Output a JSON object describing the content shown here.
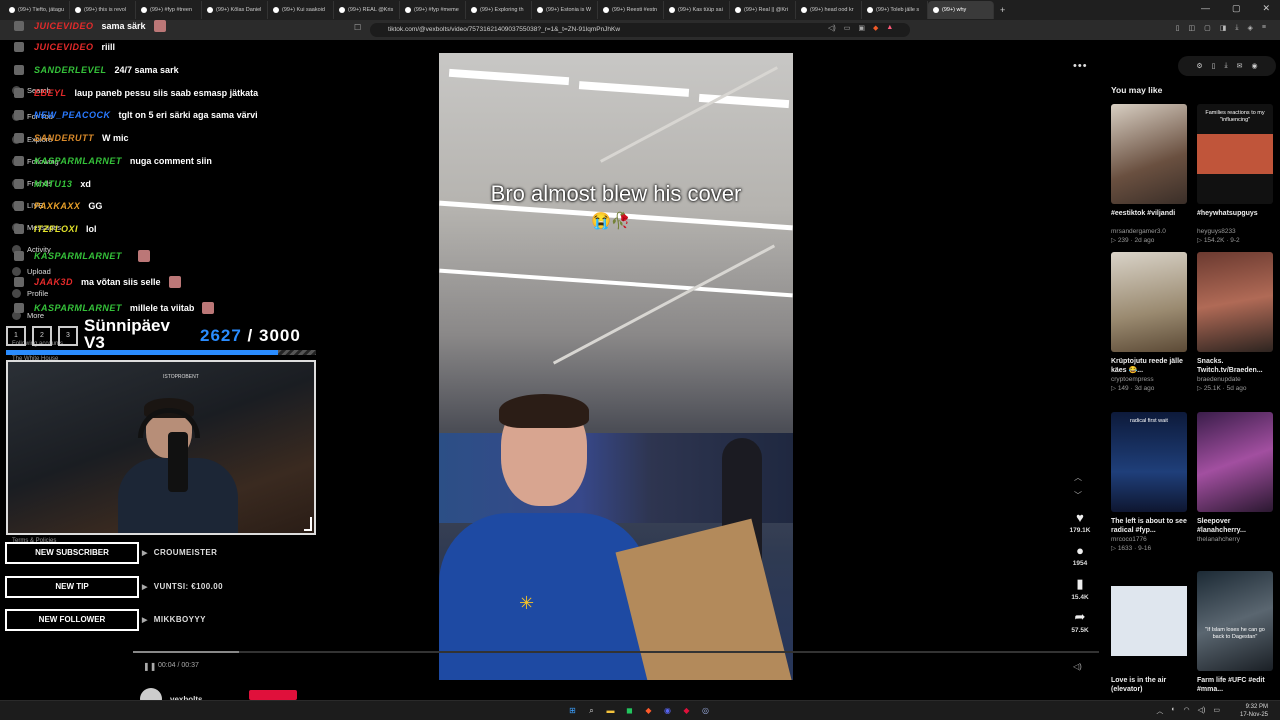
{
  "browser": {
    "tabs": [
      {
        "title": "(99+) Tiefto, jätagu"
      },
      {
        "title": "(99+) this is revol"
      },
      {
        "title": "(99+) #fyp #treen"
      },
      {
        "title": "(99+) Kõlas Daniel"
      },
      {
        "title": "(99+) Kui saakoid"
      },
      {
        "title": "(99+) REAL @Kris"
      },
      {
        "title": "(99+) #fyp #meme"
      },
      {
        "title": "(99+) Exploring th"
      },
      {
        "title": "(99+) Estonia is W"
      },
      {
        "title": "(99+) Reesti #estn"
      },
      {
        "title": "(99+) Kas tüüp sai"
      },
      {
        "title": "(99+) Real || @Kri"
      },
      {
        "title": "(99+) head ood kr"
      },
      {
        "title": "(99+) Toleb jälle s"
      },
      {
        "title": "(99+) why"
      }
    ],
    "new_tab": "+",
    "window_controls": {
      "minimize": "—",
      "maximize": "▢",
      "close": "✕"
    },
    "url": "tiktok.com/@vexbolts/video/7573162140903755038?_r=1&_t=ZN-91lqmPnJhKw",
    "bookmark_icon": "☐"
  },
  "tiktok_nav": {
    "items": [
      {
        "label": "Search"
      },
      {
        "label": "For You"
      },
      {
        "label": "Explore"
      },
      {
        "label": "Following"
      },
      {
        "label": "Friends"
      },
      {
        "label": "LIVE"
      },
      {
        "label": "Messages"
      },
      {
        "label": "Activity"
      },
      {
        "label": "Upload"
      },
      {
        "label": "Profile"
      },
      {
        "label": "More"
      }
    ],
    "following_accounts": "Following accounts",
    "following_user": "The White House",
    "terms": "Terms & Policies"
  },
  "chat": {
    "lines": [
      {
        "user": "JUICEVIDEO",
        "color": "#e32a2a",
        "msg": "sama särk"
      },
      {
        "user": "JUICEVIDEO",
        "color": "#e32a2a",
        "msg": "riill"
      },
      {
        "user": "SANDERLEVEL",
        "color": "#35c23a",
        "msg": "24/7 sama sark"
      },
      {
        "user": "EBEYL",
        "color": "#e32a2a",
        "msg": "laup paneb pessu siis saab esmasp jätkata"
      },
      {
        "user": "NEW_PEACOCK",
        "color": "#2a7aff",
        "msg": "tglt on 5 eri särki aga sama värvi"
      },
      {
        "user": "SANDERUTT",
        "color": "#d98a2a",
        "msg": "W mic"
      },
      {
        "user": "KASPARMLARNET",
        "color": "#35c23a",
        "msg": "nuga comment siin"
      },
      {
        "user": "MATU13",
        "color": "#35c23a",
        "msg": "xd"
      },
      {
        "user": "PAXKAXX",
        "color": "#e8a02a",
        "msg": "GG"
      },
      {
        "user": "ITZFLOXI",
        "color": "#e3e32a",
        "msg": "lol"
      },
      {
        "user": "KASPARMLARNET",
        "color": "#35c23a",
        "msg": ""
      },
      {
        "user": "JAAK3D",
        "color": "#e32a2a",
        "msg": "ma võtan siis selle"
      },
      {
        "user": "KASPARMLARNET",
        "color": "#35c23a",
        "msg": "millele ta viitab"
      }
    ]
  },
  "goal": {
    "slots": [
      "1",
      "2",
      "3"
    ],
    "title_line1": "Sünnipäev",
    "title_line2": "V3",
    "current": "2627",
    "separator": " / ",
    "target": "3000",
    "progress_fraction": 0.876
  },
  "webcam": {
    "overlay_text": "ISTOPROBENT"
  },
  "alerts": [
    {
      "label": "NEW SUBSCRIBER",
      "value": "CROUMEISTER"
    },
    {
      "label": "NEW TIP",
      "value": "VUNTSI: €100.00"
    },
    {
      "label": "NEW FOLLOWER",
      "value": "MIKKBOYYY"
    }
  ],
  "video": {
    "caption": "Bro almost blew his cover",
    "caption_emoji": "😭🥀",
    "time": "00:04 / 00:37",
    "progress_fraction": 0.11,
    "creator": "vexbolts",
    "more_icon": "•••"
  },
  "actions": {
    "likes": "179.1K",
    "comments": "1954",
    "saves": "15.4K",
    "shares": "57.5K"
  },
  "recommendations": {
    "heading": "You may like",
    "cards": [
      {
        "title": "#eestiktok #viljandi",
        "author": "mrsandergamer3.0",
        "views": "239",
        "date": "2d ago",
        "thumb": "linear-gradient(160deg,#d8cfc3,#6a5040 60%,#3a2e28)",
        "overlay": ""
      },
      {
        "title": "#heywhatsupguys",
        "author": "heyguys8233",
        "views": "154.2K",
        "date": "9-2",
        "thumb": "linear-gradient(180deg,#111 0 30%,#c0553a 30% 70%,#111 70%)",
        "overlay": "Families reactions to my \"influencing\""
      },
      {
        "title": "Krüptojutu reede jälle käes 😂...",
        "author": "cryptoempress",
        "views": "149",
        "date": "3d ago",
        "thumb": "linear-gradient(170deg,#d9d3c8,#9a8a70 60%,#5c4a36)",
        "overlay": ""
      },
      {
        "title": "Snacks. Twitch.tv/Braeden...",
        "author": "braedenupdate",
        "views": "25.1K",
        "date": "5d ago",
        "thumb": "linear-gradient(170deg,#6b3a30,#b06a56 50%,#2d2420)",
        "overlay": ""
      },
      {
        "title": "The left is about to see radical #fyp...",
        "author": "mrcoco1776",
        "views": "1633",
        "date": "9-16",
        "thumb": "linear-gradient(180deg,#0d1a3a,#1f3f7a 60%,#0e1630)",
        "overlay": "radical first wait"
      },
      {
        "title": "Sleepover #lanahcherry...",
        "author": "thelanahcherry",
        "views": "",
        "date": "",
        "thumb": "linear-gradient(160deg,#3a1d4a,#a24fa0 50%,#2a1830)",
        "overlay": ""
      },
      {
        "title": "Love is in the air (elevator)",
        "author": "",
        "views": "",
        "date": "",
        "thumb": "linear-gradient(180deg,#000 0 15%,#dfe6ee 15% 85%,#000 85%)",
        "overlay": ""
      },
      {
        "title": "Farm life #UFC #edit #mma...",
        "author": "",
        "views": "",
        "date": "",
        "thumb": "linear-gradient(160deg,#1c2a35,#5a6670 50%,#1a1f25)",
        "overlay": "\"If Islam loses he can go back to Dagestan\""
      }
    ]
  },
  "taskbar": {
    "time": "9:32 PM",
    "date": "17-Nov-25"
  }
}
